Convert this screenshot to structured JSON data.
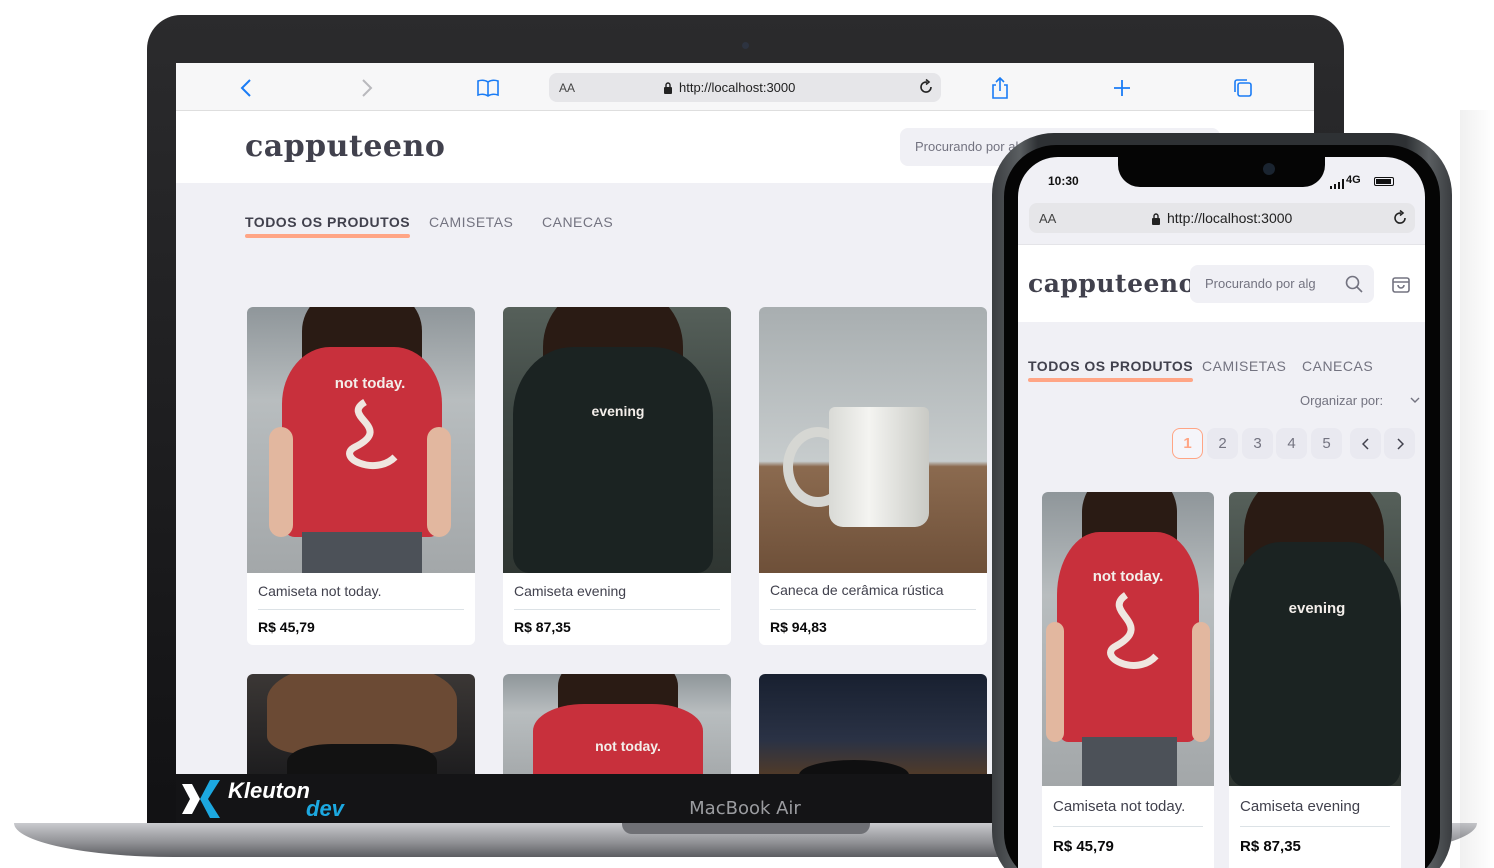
{
  "laptop": {
    "device_label": "MacBook Air",
    "watermark": {
      "name": "Kleuton",
      "sub": "dev"
    },
    "browser": {
      "aa": "AA",
      "url": "http://localhost:3000"
    },
    "site": {
      "logo": "capputeeno",
      "search_placeholder": "Procurando por algo específico?",
      "tabs": [
        "TODOS OS PRODUTOS",
        "CAMISETAS",
        "CANECAS"
      ],
      "products": [
        {
          "name": "Camiseta not today.",
          "price": "R$ 45,79",
          "shirt_text": "not today."
        },
        {
          "name": "Camiseta evening",
          "price": "R$ 87,35",
          "shirt_text": "evening"
        },
        {
          "name": "Caneca de cerâmica rústica",
          "price": "R$ 94,83"
        }
      ],
      "row2_shirt_text": "not today."
    }
  },
  "phone": {
    "status": {
      "time": "10:30",
      "network": "4G"
    },
    "browser": {
      "aa": "AA",
      "url": "http://localhost:3000"
    },
    "site": {
      "logo": "capputeeno",
      "search_placeholder": "Procurando por alg",
      "tabs": [
        "TODOS OS PRODUTOS",
        "CAMISETAS",
        "CANECAS"
      ],
      "sort_label": "Organizar por:",
      "pages": [
        "1",
        "2",
        "3",
        "4",
        "5"
      ],
      "current_page": "1",
      "products": [
        {
          "name": "Camiseta not today.",
          "price": "R$ 45,79",
          "shirt_text": "not today."
        },
        {
          "name": "Camiseta evening",
          "price": "R$ 87,35",
          "shirt_text": "evening"
        }
      ]
    }
  },
  "colors": {
    "accent": "#ffa585",
    "text": "#41414d",
    "muted": "#737380",
    "bg": "#f0f0f5",
    "brand_blue": "#1ca8e0"
  }
}
